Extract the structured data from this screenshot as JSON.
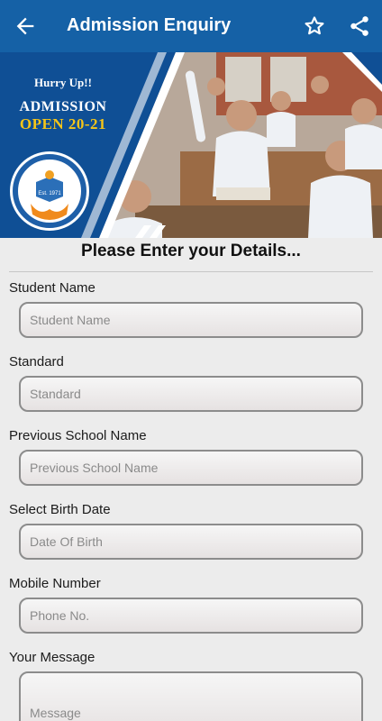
{
  "appbar": {
    "title": "Admission Enquiry",
    "back_icon": "arrow-left-icon",
    "favorite_icon": "star-outline-icon",
    "share_icon": "share-icon",
    "color": "#1561a6"
  },
  "banner": {
    "hurry": "Hurry Up!!",
    "line1": "ADMISSION",
    "line2": "OPEN 20-21",
    "logo_est": "Est. 1971"
  },
  "form": {
    "heading": "Please Enter your Details...",
    "fields": [
      {
        "label": "Student Name",
        "placeholder": "Student Name",
        "value": ""
      },
      {
        "label": "Standard",
        "placeholder": "Standard",
        "value": ""
      },
      {
        "label": "Previous School Name",
        "placeholder": "Previous School Name",
        "value": ""
      },
      {
        "label": "Select Birth Date",
        "placeholder": "Date Of Birth",
        "value": ""
      },
      {
        "label": "Mobile Number",
        "placeholder": "Phone No.",
        "value": ""
      },
      {
        "label": "Your Message",
        "placeholder": "Message",
        "value": ""
      }
    ]
  }
}
